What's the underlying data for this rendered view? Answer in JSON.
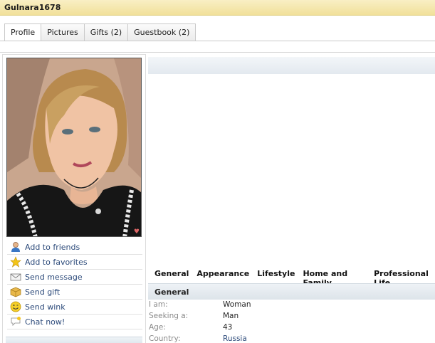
{
  "profile": {
    "username": "Gulnara1678"
  },
  "tabs": [
    {
      "label": "Profile",
      "active": true
    },
    {
      "label": "Pictures"
    },
    {
      "label": "Gifts (2)"
    },
    {
      "label": "Guestbook (2)"
    }
  ],
  "actions": [
    {
      "label": "Add to friends",
      "icon": "user-icon"
    },
    {
      "label": "Add to favorites",
      "icon": "star-icon"
    },
    {
      "label": "Send message",
      "icon": "envelope-icon"
    },
    {
      "label": "Send gift",
      "icon": "gift-box-icon"
    },
    {
      "label": "Send wink",
      "icon": "smiley-icon"
    },
    {
      "label": "Chat now!",
      "icon": "chat-bubble-icon"
    }
  ],
  "sections": [
    "General",
    "Appearance",
    "Lifestyle",
    "Home and Family",
    "Professional Life"
  ],
  "general": {
    "heading": "General",
    "rows": [
      {
        "key": "I am:",
        "value": "Woman"
      },
      {
        "key": "Seeking a:",
        "value": "Man"
      },
      {
        "key": "Age:",
        "value": "43"
      },
      {
        "key": "Country:",
        "value": "Russia"
      }
    ]
  },
  "colors": {
    "title_bar": "#f1e09a",
    "link": "#2c4a7a"
  }
}
